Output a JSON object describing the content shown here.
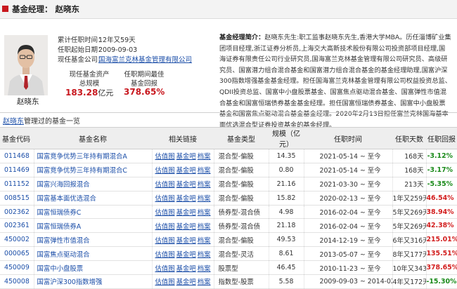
{
  "header": {
    "title": "基金经理：",
    "manager_name": "赵晓东"
  },
  "profile": {
    "name": "赵晓东",
    "tenure_label": "累计任职时间：",
    "tenure_value": "12年又59天",
    "start_label": "任职起始日期：",
    "start_value": "2009-09-03",
    "company_label": "现任基金公司：",
    "company_value": "国海富兰克林基金管理有限公司",
    "assets_label_1": "现任基金资产",
    "assets_label_2": "总规模",
    "assets_value": "183.28",
    "assets_unit": "亿元",
    "best_label_1": "任职期间最佳",
    "best_label_2": "基金回报",
    "best_value": "378.65%",
    "bio_label": "基金经理简介：",
    "bio_text": "赵晓东先生:职工监事赵晓东先生,香港大学MBA。历任淄博矿业集团项目经理,浙江证券分析员,上海交大高新技术股份有限公司投资部项目经理,国海证券有限责任公司行业研究员,国海富兰克林基金管理有限公司研究员、高级研究员、国富潜力组合混合基金和国富潜力组合混合基金的基金经理助理,国富沪深300指数增强基金基金经理。担任国海富兰克林基金管理有限公司权益投资总监、QDII投资总监、国富中小盘股票基金、国富焦点驱动混合基金、国富弹性市值混合基金和国富恒瑞债券基金基金经理。担任国富恒瑞债券基金、国富中小盘股票基金和国富焦点驱动混合基金基金经理。2020年2月13日担任富兰克林国海基本面优选混合型证券投资基金的基金经理。"
  },
  "section": {
    "manager_link": "赵晓东",
    "title_suffix": "管理过的基金一览"
  },
  "table": {
    "headers": [
      "基金代码",
      "基金名称",
      "相关链接",
      "基金类型",
      "规模（亿元）",
      "任职时间",
      "任职天数",
      "任职回报"
    ],
    "link_labels": [
      "估值图",
      "基金吧",
      "档案"
    ],
    "rows": [
      {
        "code": "011468",
        "name": "国富竞争优势三年持有期混合A",
        "type": "混合型-偏股",
        "size": "14.35",
        "period": "2021-05-14 ~ 至今",
        "days": "168天",
        "ret": "-3.12%",
        "neg": true
      },
      {
        "code": "011469",
        "name": "国富竞争优势三年持有期混合C",
        "type": "混合型-偏股",
        "size": "0.80",
        "period": "2021-05-14 ~ 至今",
        "days": "168天",
        "ret": "-3.17%",
        "neg": true
      },
      {
        "code": "011152",
        "name": "国富兴海回报混合",
        "type": "混合型-偏股",
        "size": "21.16",
        "period": "2021-03-30 ~ 至今",
        "days": "213天",
        "ret": "-5.35%",
        "neg": true
      },
      {
        "code": "008515",
        "name": "国富基本面优选混合",
        "type": "混合型-偏股",
        "size": "15.82",
        "period": "2020-02-13 ~ 至今",
        "days": "1年又259天",
        "ret": "46.54%",
        "neg": false
      },
      {
        "code": "002362",
        "name": "国富恒瑞债券C",
        "type": "债券型-混合债",
        "size": "4.98",
        "period": "2016-02-04 ~ 至今",
        "days": "5年又269天",
        "ret": "38.94%",
        "neg": false
      },
      {
        "code": "002361",
        "name": "国富恒瑞债券A",
        "type": "债券型-混合债",
        "size": "21.18",
        "period": "2016-02-04 ~ 至今",
        "days": "5年又269天",
        "ret": "42.38%",
        "neg": false
      },
      {
        "code": "450002",
        "name": "国富弹性市值混合",
        "type": "混合型-偏股",
        "size": "49.53",
        "period": "2014-12-19 ~ 至今",
        "days": "6年又316天",
        "ret": "215.01%",
        "neg": false
      },
      {
        "code": "000065",
        "name": "国富焦点驱动混合",
        "type": "混合型-灵活",
        "size": "8.61",
        "period": "2013-05-07 ~ 至今",
        "days": "8年又177天",
        "ret": "135.51%",
        "neg": false
      },
      {
        "code": "450009",
        "name": "国富中小盘股票",
        "type": "股票型",
        "size": "46.45",
        "period": "2010-11-23 ~ 至今",
        "days": "10年又343天",
        "ret": "378.65%",
        "neg": false
      },
      {
        "code": "450008",
        "name": "国富沪深300指数增强",
        "type": "指数型-股票",
        "size": "5.58",
        "period": "2009-09-03 ~ 2014-02-21",
        "days": "4年又172天",
        "ret": "-15.30%",
        "neg": true
      }
    ]
  },
  "colors": {
    "accent_red": "#c8171e",
    "link_blue": "#1b4ea8",
    "negative_green": "#1a8a1a",
    "positive_red": "#d21d1d"
  }
}
